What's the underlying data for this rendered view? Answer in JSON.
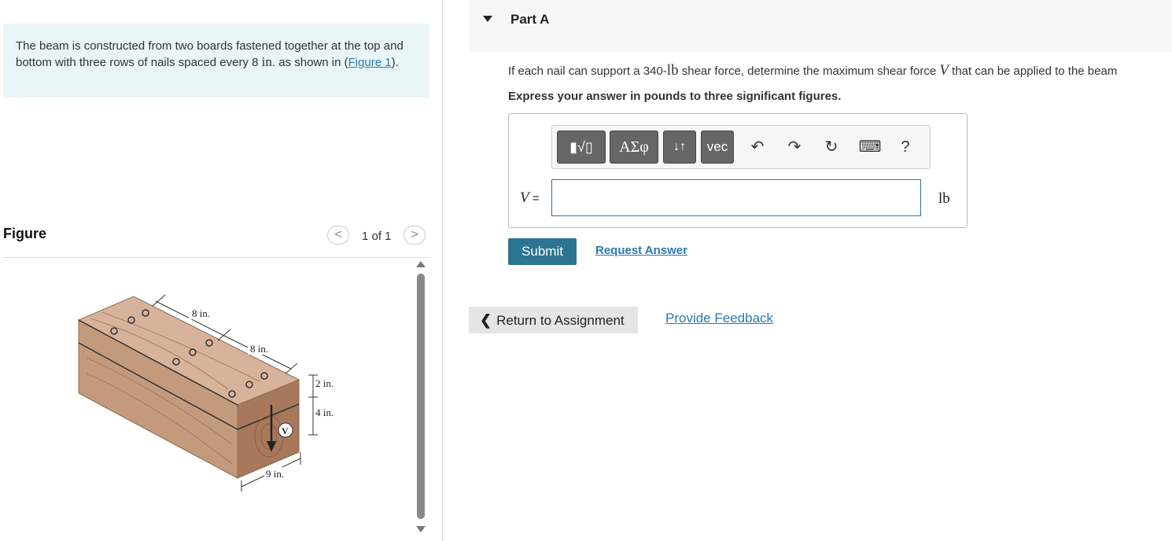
{
  "problem": {
    "text_before": "The beam is constructed from two boards fastened together at the top and bottom with three rows of nails spaced every 8 ",
    "unit": "in",
    "text_after": ". as shown in",
    "link_open": "(",
    "link_text": "Figure 1",
    "link_close": ")."
  },
  "figure": {
    "title": "Figure",
    "page_count": "1 of 1",
    "prev_symbol": "<",
    "next_symbol": ">",
    "labels": {
      "spacing1": "8 in.",
      "spacing2": "8 in.",
      "height_top": "2 in.",
      "height_bottom": "4 in.",
      "width": "9 in.",
      "force": "V"
    },
    "colors": {
      "wood_light": "#d6b39a",
      "wood_mid": "#c49a7d",
      "wood_dark": "#a7785b"
    }
  },
  "part": {
    "title": "Part A",
    "question_before": "If each nail can support a 340-",
    "question_unit": "lb",
    "question_middle": " shear force, determine the maximum shear force ",
    "question_var": "V",
    "question_after": " that can be applied to the beam",
    "instruction": "Express your answer in pounds to three significant figures."
  },
  "toolbar": {
    "template": "▮√▯",
    "greek": "ΑΣφ",
    "arrows": "↓↑",
    "vec": "vec",
    "undo_icon": "↶",
    "redo_icon": "↷",
    "reset_icon": "↻",
    "keyboard_icon": "⌨",
    "help": "?"
  },
  "answer": {
    "variable": "V",
    "equals": " =",
    "value": "",
    "unit": "lb"
  },
  "actions": {
    "submit": "Submit",
    "request": "Request Answer",
    "return": "Return to Assignment",
    "return_icon": "❮",
    "feedback": "Provide Feedback"
  }
}
